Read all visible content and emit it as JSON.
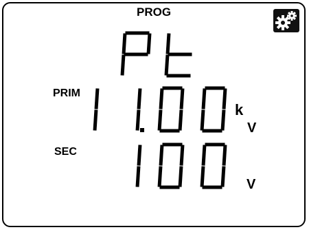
{
  "header": {
    "mode": "PROG"
  },
  "toolbar": {
    "settings_icon": "gears-icon"
  },
  "display": {
    "parameter": "Pt",
    "primary": {
      "label": "PRIM",
      "value": "11.00",
      "prefix": "k",
      "unit": "V"
    },
    "secondary": {
      "label": "SEC",
      "value": "100",
      "unit": "V"
    }
  }
}
